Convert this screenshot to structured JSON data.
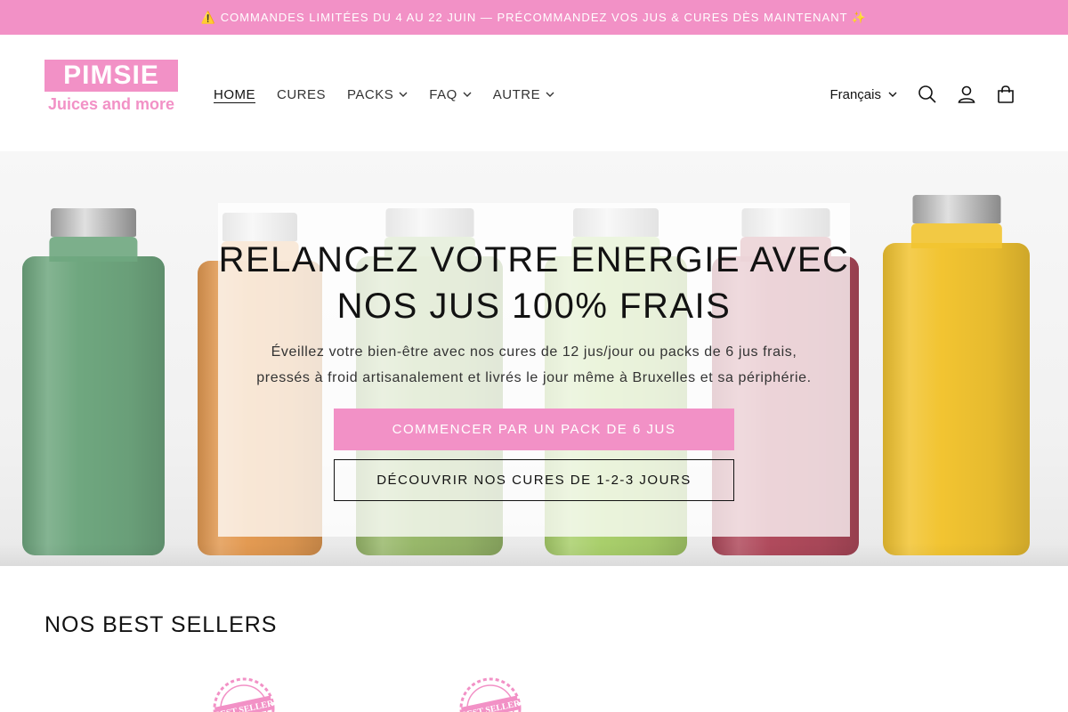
{
  "announcement": {
    "text": "⚠️ COMMANDES LIMITÉES DU 4 AU 22 JUIN — PRÉCOMMANDEZ VOS JUS & CURES DÈS MAINTENANT ✨"
  },
  "brand": {
    "name": "PIMSIE",
    "tagline": "Juices and more",
    "accent_color": "#f291c6"
  },
  "nav": {
    "items": [
      {
        "label": "HOME",
        "active": true,
        "dropdown": false
      },
      {
        "label": "CURES",
        "active": false,
        "dropdown": false
      },
      {
        "label": "PACKS",
        "active": false,
        "dropdown": true
      },
      {
        "label": "FAQ",
        "active": false,
        "dropdown": true
      },
      {
        "label": "AUTRE",
        "active": false,
        "dropdown": true
      }
    ]
  },
  "header": {
    "language": "Français",
    "icons": [
      "search-icon",
      "account-icon",
      "cart-icon"
    ]
  },
  "hero": {
    "title": "RELANCEZ VOTRE ENERGIE AVEC NOS JUS 100% FRAIS",
    "text": "Éveillez votre bien-être avec nos cures de 12 jus/jour ou packs de 6 jus frais, pressés à froid artisanalement et livrés le jour même à Bruxelles et sa périphérie.",
    "primary_button": "COMMENCER PAR UN PACK DE 6 JUS",
    "secondary_button": "DÉCOUVRIR NOS CURES DE 1-2-3 JOURS",
    "bottle_colors": [
      "#6fa77f",
      "#e39a52",
      "#98b86a",
      "#a9cf6b",
      "#b04a5c",
      "#f2c431"
    ]
  },
  "best_sellers": {
    "title": "NOS BEST SELLERS",
    "badge_text": "BEST SELLER"
  }
}
